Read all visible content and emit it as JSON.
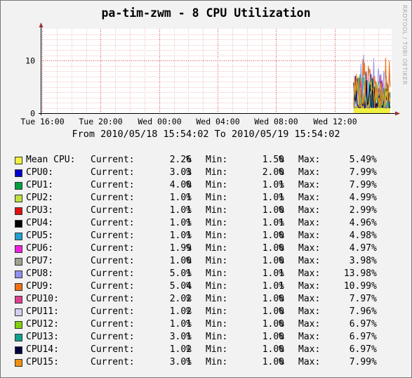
{
  "title": "pa-tim-zwm - 8 CPU Utilization",
  "watermark": "RRDTOOL / TOBI OETIKER",
  "time_range": "From 2010/05/18 15:54:02 To 2010/05/19 15:54:02",
  "colors": {
    "background": "#f2f2f2",
    "plot_background": "#ffffff",
    "grid_minor": "#f0c8c8",
    "grid_major": "#e07070",
    "axis": "#000000",
    "arrow": "#a03030"
  },
  "legend_labels": {
    "current": "Current:",
    "min": "Min:",
    "max": "Max:",
    "unit": "%"
  },
  "chart_data": {
    "type": "line",
    "x_ticks": [
      "Tue 16:00",
      "Tue 20:00",
      "Wed 00:00",
      "Wed 04:00",
      "Wed 08:00",
      "Wed 12:00"
    ],
    "x_tick_hours": [
      0.1,
      4.1,
      8.1,
      12.1,
      16.1,
      20.1
    ],
    "x_range_hours": [
      0,
      24
    ],
    "y_ticks": [
      "0",
      "10"
    ],
    "y_tick_values": [
      0,
      10
    ],
    "ylim": [
      0,
      16
    ],
    "data_start_hour": 21.4,
    "grid": true,
    "series": [
      {
        "name": "Mean CPU",
        "color": "#f0f040",
        "current": "2.26",
        "min": "1.50",
        "max": "5.49",
        "area": true
      },
      {
        "name": "CPU0",
        "color": "#0000d0",
        "current": "3.03",
        "min": "2.00",
        "max": "7.99"
      },
      {
        "name": "CPU1",
        "color": "#00a040",
        "current": "4.00",
        "min": "1.01",
        "max": "7.99"
      },
      {
        "name": "CPU2",
        "color": "#c0e040",
        "current": "1.01",
        "min": "1.01",
        "max": "4.99"
      },
      {
        "name": "CPU3",
        "color": "#e01010",
        "current": "1.01",
        "min": "1.00",
        "max": "2.99"
      },
      {
        "name": "CPU4",
        "color": "#000000",
        "current": "1.01",
        "min": "1.01",
        "max": "4.96"
      },
      {
        "name": "CPU5",
        "color": "#20a0d0",
        "current": "1.01",
        "min": "1.00",
        "max": "4.98"
      },
      {
        "name": "CPU6",
        "color": "#f020e0",
        "current": "1.99",
        "min": "1.00",
        "max": "4.97"
      },
      {
        "name": "CPU7",
        "color": "#a0a090",
        "current": "1.00",
        "min": "1.00",
        "max": "3.98"
      },
      {
        "name": "CPU8",
        "color": "#9090f0",
        "current": "5.01",
        "min": "1.01",
        "max": "13.98"
      },
      {
        "name": "CPU9",
        "color": "#f07010",
        "current": "5.04",
        "min": "1.01",
        "max": "10.99"
      },
      {
        "name": "CPU10",
        "color": "#e04090",
        "current": "2.02",
        "min": "1.00",
        "max": "7.97"
      },
      {
        "name": "CPU11",
        "color": "#d0d0f0",
        "current": "1.02",
        "min": "1.00",
        "max": "7.96"
      },
      {
        "name": "CPU12",
        "color": "#80d010",
        "current": "1.01",
        "min": "1.00",
        "max": "6.97"
      },
      {
        "name": "CPU13",
        "color": "#10a090",
        "current": "3.01",
        "min": "1.00",
        "max": "6.97"
      },
      {
        "name": "CPU14",
        "color": "#000040",
        "current": "1.02",
        "min": "1.00",
        "max": "6.97"
      },
      {
        "name": "CPU15",
        "color": "#f09010",
        "current": "3.01",
        "min": "1.00",
        "max": "7.99"
      }
    ]
  }
}
